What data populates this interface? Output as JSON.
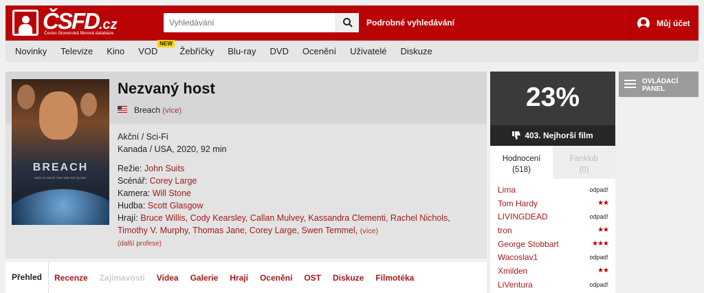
{
  "header": {
    "logo_text": "ČSFD",
    "logo_domain": ".cz",
    "logo_sub": "Česko-Slovenská filmová databáze",
    "search_placeholder": "Vyhledávání",
    "advanced_search": "Podrobné vyhledávání",
    "account": "Můj účet"
  },
  "nav": {
    "items": [
      "Novinky",
      "Televize",
      "Kino",
      "VOD",
      "Žebříčky",
      "Blu-ray",
      "DVD",
      "Ocenění",
      "Uživatelé",
      "Diskuze"
    ],
    "vod_badge": "NEW"
  },
  "film": {
    "title": "Nezvaný host",
    "original_title": "Breach",
    "more": "(více)",
    "genre": "Akční / Sci-Fi",
    "origin": "Kanada / USA, 2020, 92 min",
    "poster_title": "BREACH",
    "poster_tagline": "DEEP IN SPACE THEY ARE NOT ALONE.",
    "crew": {
      "director_label": "Režie:",
      "director": "John Suits",
      "writer_label": "Scénář:",
      "writer": "Corey Large",
      "camera_label": "Kamera:",
      "camera": "Will Stone",
      "music_label": "Hudba:",
      "music": "Scott Glasgow",
      "cast_label": "Hrají:",
      "cast_line1": "Bruce Willis, Cody Kearsley, Callan Mulvey, Kassandra Clementi, Rachel Nichols,",
      "cast_line2": "Timothy V. Murphy, Thomas Jane, Corey Large, Swen Temmel,",
      "cast_more": "(více)",
      "other_professions": "(další profese)"
    }
  },
  "tabs": [
    "Přehled",
    "Recenze",
    "Zajímavosti",
    "Videa",
    "Galerie",
    "Hrají",
    "Ocenění",
    "OST",
    "Diskuze",
    "Filmotéka"
  ],
  "rating": {
    "percent": "23%",
    "worst": "403. Nejhorší film",
    "tab_ratings": "Hodnocení",
    "tab_ratings_count": "(518)",
    "tab_fanclub": "Fanklub",
    "tab_fanclub_count": "(0)",
    "users": [
      {
        "name": "Lima",
        "value": "odpad!",
        "stars": 0
      },
      {
        "name": "Tom Hardy",
        "value": "",
        "stars": 2
      },
      {
        "name": "LIVINGDEAD",
        "value": "odpad!",
        "stars": 0
      },
      {
        "name": "tron",
        "value": "",
        "stars": 2
      },
      {
        "name": "George Stobbart",
        "value": "",
        "stars": 3
      },
      {
        "name": "Wacoslav1",
        "value": "odpad!",
        "stars": 0
      },
      {
        "name": "Xmilden",
        "value": "",
        "stars": 2
      },
      {
        "name": "LiVentura",
        "value": "odpad!",
        "stars": 0
      }
    ]
  },
  "control_panel": {
    "line1": "OVLÁDACÍ",
    "line2": "PANEL"
  },
  "colors": {
    "brand": "#ba0305",
    "link": "#a31a1a",
    "rating_dark": "#3a3a3a"
  }
}
